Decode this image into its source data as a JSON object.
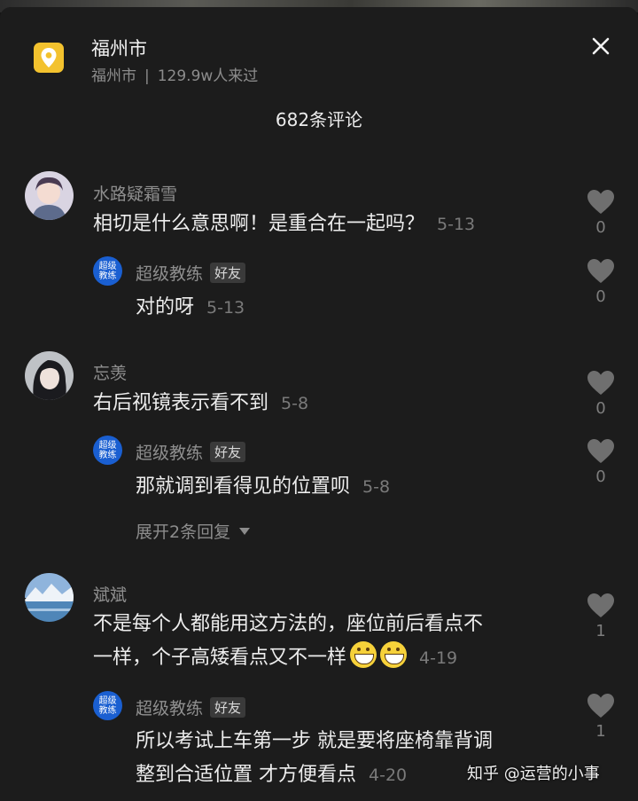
{
  "header": {
    "location_name": "福州市",
    "location_sub": "福州市",
    "separator": "|",
    "visitors": "129.9w人来过",
    "location_icon": "map-pin-icon",
    "close_icon": "close-icon"
  },
  "comments_title": "682条评论",
  "comments": [
    {
      "user": "水路疑霜雪",
      "text": "相切是什么意思啊！是重合在一起吗？",
      "time": "5-13",
      "likes": "0",
      "reply": {
        "avatar_text": "超级教练",
        "user": "超级教练",
        "badge": "好友",
        "text": "对的呀",
        "time": "5-13",
        "likes": "0"
      }
    },
    {
      "user": "忘羡",
      "text": "右后视镜表示看不到",
      "time": "5-8",
      "likes": "0",
      "reply": {
        "avatar_text": "超级教练",
        "user": "超级教练",
        "badge": "好友",
        "text": "那就调到看得见的位置呗",
        "time": "5-8",
        "likes": "0"
      },
      "expand_label": "展开2条回复"
    },
    {
      "user": "斌斌",
      "text_line1": "不是每个人都能用这方法的，座位前后看点不",
      "text_line2": "一样，个子高矮看点又不一样",
      "time": "4-19",
      "likes": "1",
      "reply": {
        "avatar_text": "超级教练",
        "user": "超级教练",
        "badge": "好友",
        "text_line1": "所以考试上车第一步 就是要将座椅靠背调",
        "text_line2": "整到合适位置 才方便看点",
        "time": "4-20",
        "likes": "1"
      }
    }
  ],
  "watermark": "知乎 @运营的小事",
  "colors": {
    "background": "#1c1c1c",
    "badge_blue": "#1a5fd1",
    "pin_yellow": "#f3c22e"
  }
}
